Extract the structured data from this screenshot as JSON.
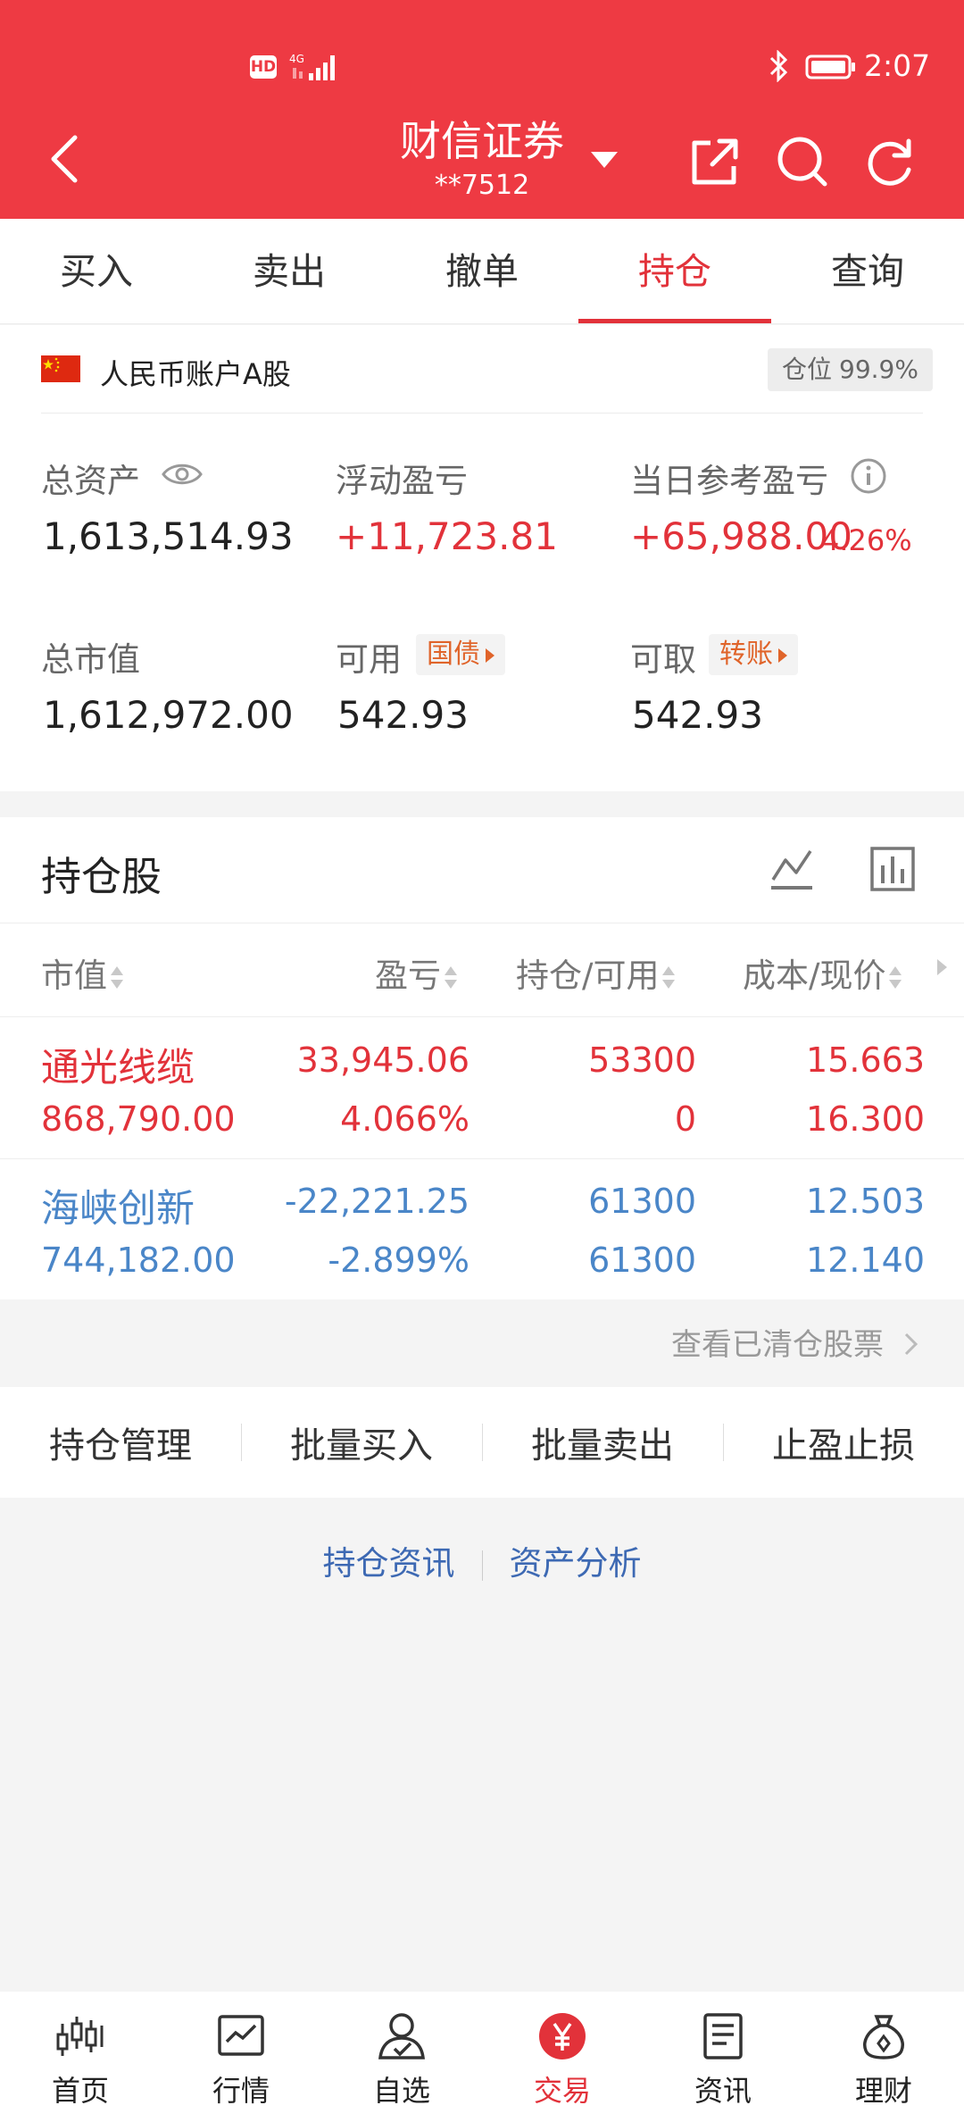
{
  "status_bar": {
    "hd": "HD",
    "network": "4G",
    "time": "2:07",
    "battery_icon": "battery-full-icon",
    "bluetooth_icon": "bluetooth-icon"
  },
  "header": {
    "title": "财信证券",
    "account": "**7512",
    "icons": [
      "back-icon",
      "dropdown-caret-icon",
      "share-icon",
      "search-icon",
      "refresh-icon"
    ]
  },
  "tabs": [
    {
      "label": "买入"
    },
    {
      "label": "卖出"
    },
    {
      "label": "撤单"
    },
    {
      "label": "持仓",
      "active": true
    },
    {
      "label": "查询"
    }
  ],
  "account_card": {
    "flag_icon": "china-flag-icon",
    "account_type": "人民币账户A股",
    "position_label": "仓位",
    "position_value": "99.9%",
    "total_assets_label": "总资产",
    "total_assets": "1,613,514.93",
    "floating_pl_label": "浮动盈亏",
    "floating_pl": "+11,723.81",
    "daily_pl_label": "当日参考盈亏",
    "daily_pl": "+65,988.00",
    "daily_pl_pct": "4.26%",
    "market_value_label": "总市值",
    "market_value": "1,612,972.00",
    "available_label": "可用",
    "available": "542.93",
    "bond_tag": "国债",
    "withdrawable_label": "可取",
    "withdrawable": "542.93",
    "transfer_tag": "转账"
  },
  "holdings": {
    "title": "持仓股",
    "columns": [
      "市值",
      "盈亏",
      "持仓/可用",
      "成本/现价"
    ],
    "rows": [
      {
        "name": "通光线缆",
        "market_value": "868,790.00",
        "pl": "33,945.06",
        "pl_pct": "4.066%",
        "position": "53300",
        "available": "0",
        "cost": "15.663",
        "price": "16.300",
        "color": "#e2323a"
      },
      {
        "name": "海峡创新",
        "market_value": "744,182.00",
        "pl": "-22,221.25",
        "pl_pct": "-2.899%",
        "position": "61300",
        "available": "61300",
        "cost": "12.503",
        "price": "12.140",
        "color": "#4a86c8"
      }
    ]
  },
  "cleared_link": "查看已清仓股票",
  "actions": [
    "持仓管理",
    "批量买入",
    "批量卖出",
    "止盈止损"
  ],
  "links": [
    "持仓资讯",
    "资产分析"
  ],
  "bottom_nav": [
    {
      "label": "首页",
      "icon": "candlestick-icon"
    },
    {
      "label": "行情",
      "icon": "chart-line-icon"
    },
    {
      "label": "自选",
      "icon": "user-check-icon"
    },
    {
      "label": "交易",
      "icon": "yuan-icon",
      "active": true
    },
    {
      "label": "资讯",
      "icon": "news-icon"
    },
    {
      "label": "理财",
      "icon": "money-bag-icon"
    }
  ],
  "colors": {
    "brand_red": "#ee3a43",
    "up_red": "#e2323a",
    "down_blue": "#4a86c8",
    "tag_orange": "#e0642a",
    "link_blue": "#3d69b3"
  }
}
